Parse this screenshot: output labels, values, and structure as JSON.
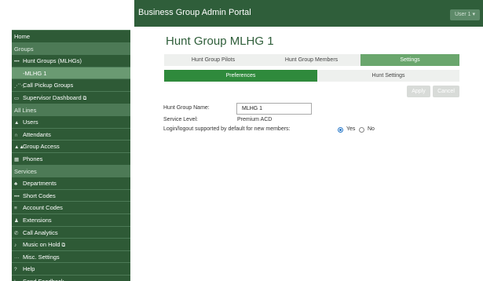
{
  "header": {
    "title": "Business Group Admin Portal",
    "user": "User 1 ▾"
  },
  "sidebar": {
    "items": [
      {
        "label": "Home",
        "icon": "",
        "type": "item",
        "name": "sidebar-item-home"
      },
      {
        "label": "Groups",
        "icon": "",
        "type": "section",
        "name": "sidebar-section-groups"
      },
      {
        "label": "Hunt Groups (MLHGs)",
        "icon": "•••",
        "type": "item",
        "name": "sidebar-item-hunt-groups"
      },
      {
        "label": "-MLHG 1",
        "icon": "",
        "type": "active",
        "name": "sidebar-item-mlhg-1"
      },
      {
        "label": "Call Pickup Groups",
        "icon": "⋰⋱",
        "type": "item",
        "name": "sidebar-item-call-pickup-groups"
      },
      {
        "label": "Supervisor Dashboard",
        "icon": "▭",
        "type": "item",
        "ext": "⧉",
        "name": "sidebar-item-supervisor-dashboard"
      },
      {
        "label": "All Lines",
        "icon": "",
        "type": "section",
        "name": "sidebar-section-all-lines"
      },
      {
        "label": "Users",
        "icon": "▲",
        "type": "item",
        "name": "sidebar-item-users"
      },
      {
        "label": "Attendants",
        "icon": "∩",
        "type": "item",
        "name": "sidebar-item-attendants"
      },
      {
        "label": "Group Access",
        "icon": "▲▲",
        "type": "item",
        "name": "sidebar-item-group-access"
      },
      {
        "label": "Phones",
        "icon": "▦",
        "type": "item",
        "name": "sidebar-item-phones"
      },
      {
        "label": "Services",
        "icon": "",
        "type": "section",
        "name": "sidebar-section-services"
      },
      {
        "label": "Departments",
        "icon": "♣",
        "type": "item",
        "name": "sidebar-item-departments"
      },
      {
        "label": "Short Codes",
        "icon": "•••",
        "type": "item",
        "name": "sidebar-item-short-codes"
      },
      {
        "label": "Account Codes",
        "icon": "≡",
        "type": "item",
        "name": "sidebar-item-account-codes"
      },
      {
        "label": "Extensions",
        "icon": "♟",
        "type": "item",
        "name": "sidebar-item-extensions"
      },
      {
        "label": "Call Analytics",
        "icon": "✆",
        "type": "item",
        "name": "sidebar-item-call-analytics"
      },
      {
        "label": "Music on Hold",
        "icon": "♪",
        "type": "item",
        "ext": "⧉",
        "name": "sidebar-item-music-on-hold"
      },
      {
        "label": "Misc. Settings",
        "icon": "···",
        "type": "item",
        "name": "sidebar-item-misc-settings"
      },
      {
        "label": "Help",
        "icon": "?",
        "type": "item",
        "name": "sidebar-item-help"
      },
      {
        "label": "Send Feedback",
        "icon": "!",
        "type": "item",
        "name": "sidebar-item-send-feedback"
      }
    ]
  },
  "main": {
    "title": "Hunt Group MLHG 1",
    "tabs": [
      {
        "label": "Hunt Group Pilots"
      },
      {
        "label": "Hunt Group Members"
      },
      {
        "label": "Settings"
      }
    ],
    "subtabs": [
      {
        "label": "Preferences"
      },
      {
        "label": "Hunt Settings"
      }
    ],
    "buttons": {
      "apply": "Apply",
      "cancel": "Cancel"
    },
    "form": {
      "name_label": "Hunt Group Name:",
      "name_value": "MLHG 1",
      "service_label": "Service Level:",
      "service_value": "Premium ACD",
      "login_label": "Login/logout supported by default for new members:",
      "yes_label": "Yes",
      "no_label": "No",
      "login_selected": "Yes"
    }
  },
  "colors": {
    "topbar": "#2f5e3a",
    "sidebar": "#2e5a36",
    "section": "#4d7a56",
    "active_tab": "#6aa66d",
    "active_subtab": "#2f8a3c",
    "radio": "#2979c9"
  }
}
